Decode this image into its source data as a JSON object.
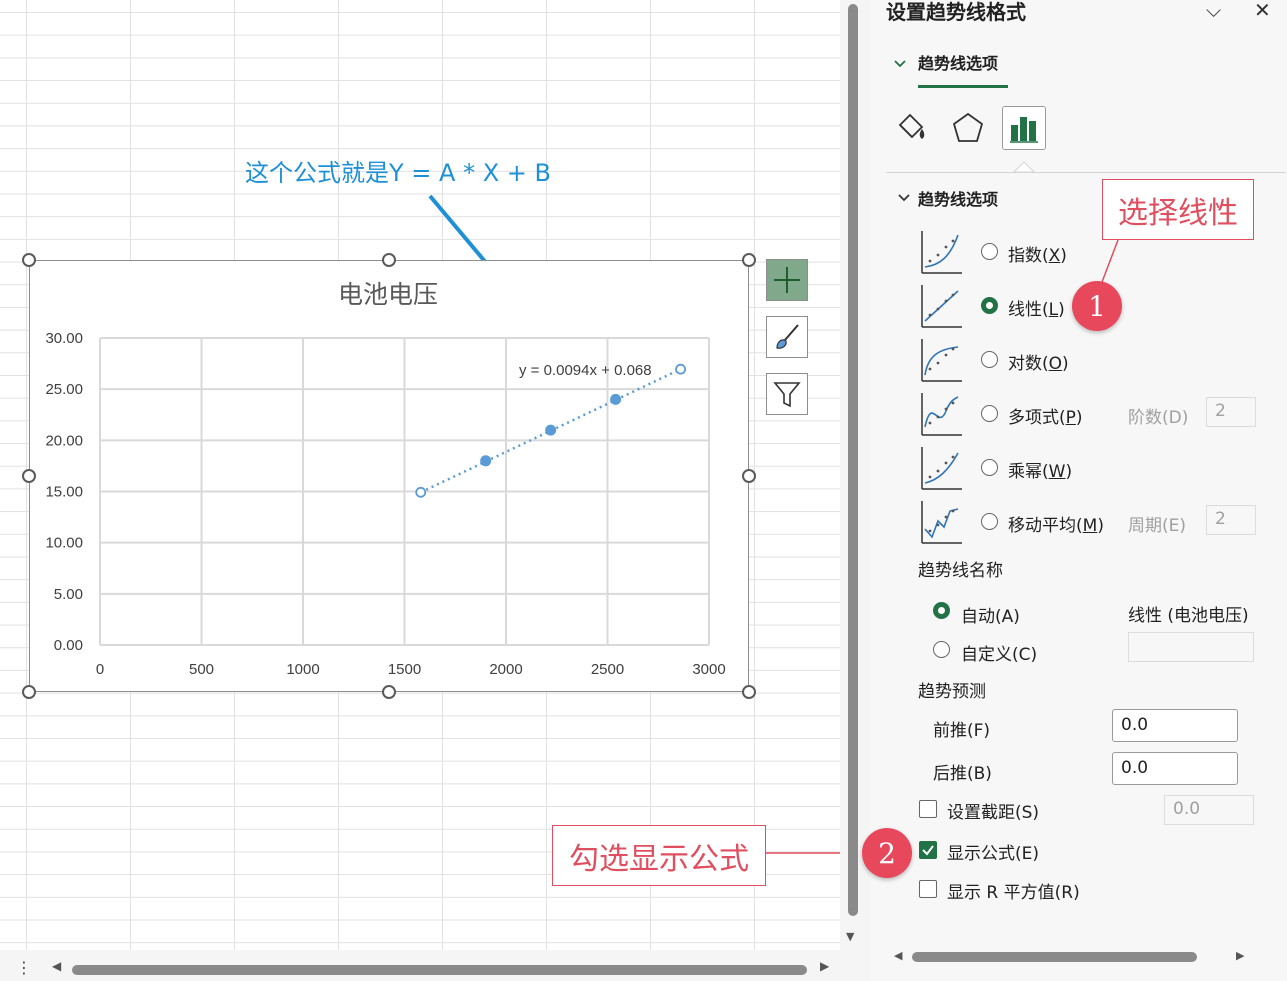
{
  "annotations": {
    "formula_note": "这个公式就是Y = A * X + B",
    "callout_linear": "选择线性",
    "callout_show_formula": "勾选显示公式",
    "badge_1": "1",
    "badge_2": "2"
  },
  "chart": {
    "trendline_label": "y = 0.0094x + 0.068"
  },
  "chart_data": {
    "type": "scatter",
    "title": "电池电压",
    "xlabel": "",
    "ylabel": "",
    "xlim": [
      0,
      3000
    ],
    "ylim": [
      0,
      30
    ],
    "x_ticks": [
      "0",
      "500",
      "1000",
      "1500",
      "2000",
      "2500",
      "3000"
    ],
    "y_ticks": [
      "0.00",
      "5.00",
      "10.00",
      "15.00",
      "20.00",
      "25.00",
      "30.00"
    ],
    "grid": true,
    "series": [
      {
        "x": [
          1580,
          1900,
          2220,
          2540
        ],
        "y": [
          15,
          18,
          21,
          24
        ],
        "color": "#5b9bd5"
      }
    ],
    "trendline": {
      "type": "linear",
      "slope": 0.0094,
      "intercept": 0.068,
      "x_range": [
        1580,
        2860
      ],
      "style": "dotted",
      "color": "#5b9bd5"
    }
  },
  "pane": {
    "title": "设置趋势线格式",
    "tab": "趋势线选项",
    "section": "趋势线选项",
    "options": [
      {
        "label": "指数(",
        "key": "X",
        "end": ")",
        "selected": false
      },
      {
        "label": "线性(",
        "key": "L",
        "end": ")",
        "selected": true
      },
      {
        "label": "对数(",
        "key": "O",
        "end": ")",
        "selected": false
      },
      {
        "label": "多项式(",
        "key": "P",
        "end": ")",
        "selected": false
      },
      {
        "label": "乘幂(",
        "key": "W",
        "end": ")",
        "selected": false
      },
      {
        "label": "移动平均(",
        "key": "M",
        "end": ")",
        "selected": false
      }
    ],
    "order_label": "阶数(D)",
    "order_value": "2",
    "period_label": "周期(E)",
    "period_value": "2",
    "name_heading": "趋势线名称",
    "name_auto": "自动(A)",
    "name_auto_value": "线性 (电池电压)",
    "name_custom": "自定义(C)",
    "forecast_heading": "趋势预测",
    "forward_label": "前推(F)",
    "forward_value": "0.0",
    "backward_label": "后推(B)",
    "backward_value": "0.0",
    "intercept_label": "设置截距(S)",
    "intercept_value": "0.0",
    "show_equation_label": "显示公式(E)",
    "show_equation_checked": true,
    "show_r2_label": "显示 R 平方值(R)",
    "show_r2_checked": false
  },
  "colors": {
    "accent_green": "#217346",
    "callout_red": "#e04f5f",
    "note_blue": "#1e90d6",
    "series_blue": "#5b9bd5"
  }
}
